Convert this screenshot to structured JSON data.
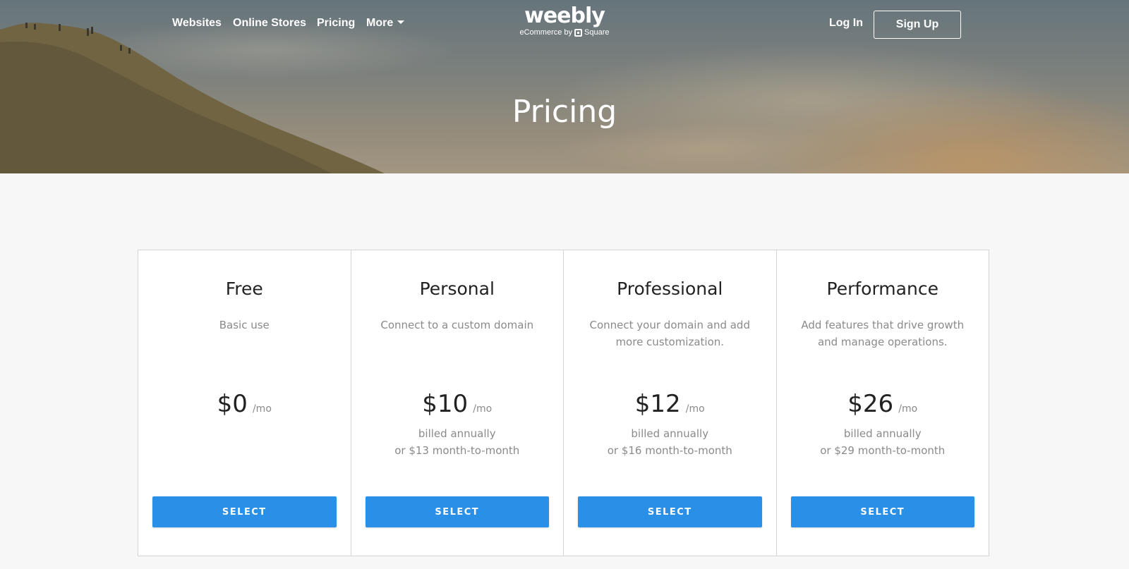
{
  "nav": {
    "links": [
      {
        "label": "Websites"
      },
      {
        "label": "Online Stores"
      },
      {
        "label": "Pricing"
      },
      {
        "label": "More"
      }
    ],
    "login_label": "Log In",
    "signup_label": "Sign Up"
  },
  "logo": {
    "wordmark": "weebly",
    "tagline_prefix": "eCommerce by",
    "tagline_brand": "Square"
  },
  "hero": {
    "title": "Pricing"
  },
  "plans": [
    {
      "name": "Free",
      "description": "Basic use",
      "price": "$0",
      "unit": "/mo",
      "billing_line1": "",
      "billing_line2": "",
      "button_label": "SELECT"
    },
    {
      "name": "Personal",
      "description": "Connect to a custom domain",
      "price": "$10",
      "unit": "/mo",
      "billing_line1": "billed annually",
      "billing_line2": "or $13 month-to-month",
      "button_label": "SELECT"
    },
    {
      "name": "Professional",
      "description": "Connect your domain and add more customization.",
      "price": "$12",
      "unit": "/mo",
      "billing_line1": "billed annually",
      "billing_line2": "or $16 month-to-month",
      "button_label": "SELECT"
    },
    {
      "name": "Performance",
      "description": "Add features that drive growth and manage operations.",
      "price": "$26",
      "unit": "/mo",
      "billing_line1": "billed annually",
      "billing_line2": "or $29 month-to-month",
      "button_label": "SELECT"
    }
  ],
  "colors": {
    "button": "#2a8fe6",
    "page_background": "#f7f7f7",
    "muted_text": "#8a8a8a"
  }
}
